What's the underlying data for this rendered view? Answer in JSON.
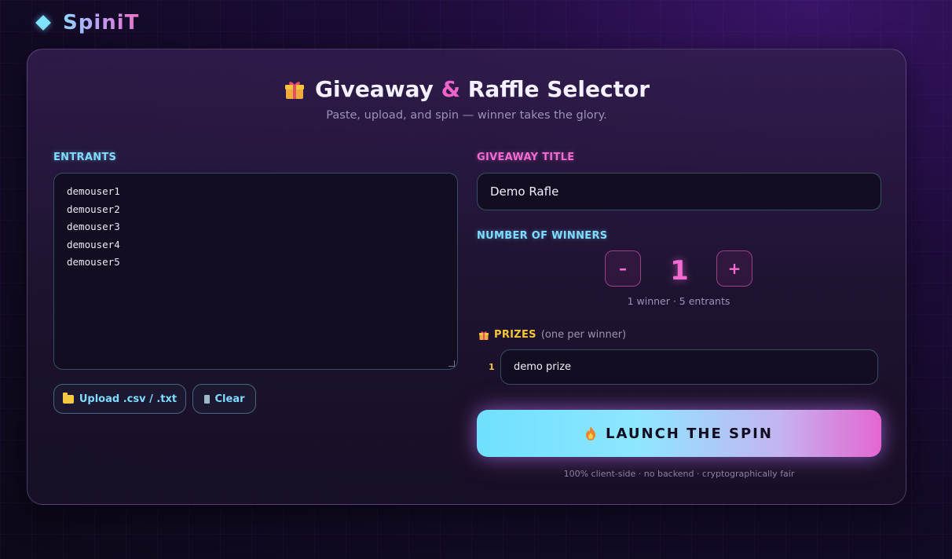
{
  "brand": {
    "name": "SpiniT"
  },
  "header": {
    "title_part1": "Giveaway",
    "title_amp": "&",
    "title_part2": "Raffle Selector",
    "subtitle": "Paste, upload, and spin — winner takes the glory."
  },
  "entrants": {
    "label": "ENTRANTS",
    "items": [
      "demouser1",
      "demouser2",
      "demouser3",
      "demouser4",
      "demouser5"
    ],
    "upload_label": "Upload .csv / .txt",
    "clear_label": "Clear"
  },
  "giveaway": {
    "title_label": "GIVEAWAY TITLE",
    "title_value": "Demo Rafle"
  },
  "winners": {
    "label": "NUMBER OF WINNERS",
    "minus_label": "–",
    "plus_label": "+",
    "count": "1",
    "note": "1 winner · 5 entrants"
  },
  "prizes": {
    "label": "PRIZES",
    "hint": "(one per winner)",
    "items": [
      {
        "number": "1",
        "value": "demo prize"
      }
    ]
  },
  "launch": {
    "label": "LAUNCH THE SPIN",
    "footnote": "100% client-side · no backend · cryptographically fair"
  },
  "colors": {
    "accent_cyan": "#7fdcff",
    "accent_pink": "#f26bd0",
    "accent_gold": "#f7c43c",
    "background": "#1c0c38"
  },
  "icons": {
    "brand": "diamond-icon",
    "title": "gift-icon",
    "upload": "folder-icon",
    "clear": "trash-icon",
    "prizes": "gift-icon",
    "launch": "flame-icon"
  }
}
